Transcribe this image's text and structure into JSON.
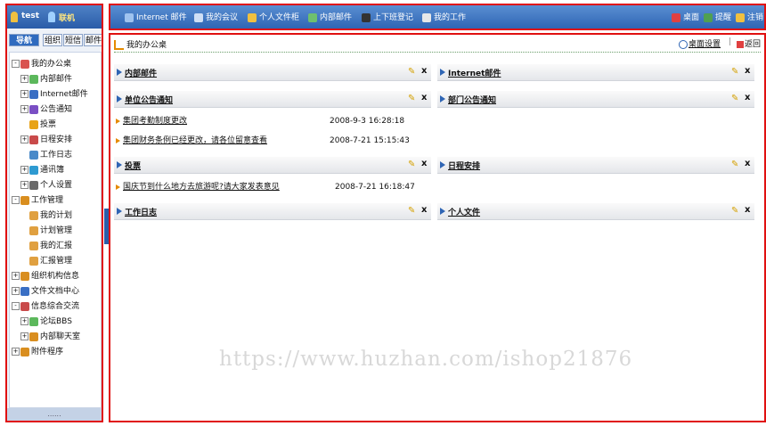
{
  "user": {
    "name": "test",
    "status": "联机"
  },
  "left_tabs": [
    "导航",
    "组织",
    "短信",
    "邮件"
  ],
  "tree": [
    {
      "label": "我的办公桌",
      "expander": "-",
      "color": "#d9534f"
    },
    {
      "label": "内部邮件",
      "expander": "+",
      "color": "#5cb85c"
    },
    {
      "label": "Internet邮件",
      "expander": "+",
      "color": "#3a6fc4"
    },
    {
      "label": "公告通知",
      "expander": "+",
      "color": "#7a4fc4"
    },
    {
      "label": "投票",
      "expander": "",
      "color": "#e8a317"
    },
    {
      "label": "日程安排",
      "expander": "+",
      "color": "#c94a4a"
    },
    {
      "label": "工作日志",
      "expander": "",
      "color": "#4a8ac9"
    },
    {
      "label": "通讯簿",
      "expander": "+",
      "color": "#2e9ad1"
    },
    {
      "label": "个人设置",
      "expander": "+",
      "color": "#6a6a6a"
    },
    {
      "label": "工作管理",
      "expander": "-",
      "color": "#d98e1f"
    },
    {
      "label": "我的计划",
      "expander": "",
      "color": "#e0a040"
    },
    {
      "label": "计划管理",
      "expander": "",
      "color": "#e0a040"
    },
    {
      "label": "我的汇报",
      "expander": "",
      "color": "#e0a040"
    },
    {
      "label": "汇报管理",
      "expander": "",
      "color": "#e0a040"
    },
    {
      "label": "组织机构信息",
      "expander": "+",
      "color": "#d98e1f"
    },
    {
      "label": "文件文档中心",
      "expander": "+",
      "color": "#3a6fc4"
    },
    {
      "label": "信息综合交流",
      "expander": "-",
      "color": "#c94a4a"
    },
    {
      "label": "论坛BBS",
      "expander": "+",
      "color": "#5cb85c"
    },
    {
      "label": "内部聊天室",
      "expander": "+",
      "color": "#d98e1f"
    },
    {
      "label": "附件程序",
      "expander": "+",
      "color": "#d98e1f"
    }
  ],
  "left_footer": "......",
  "toolbar": [
    {
      "label": "Internet 邮件",
      "color": "#9fc3ef"
    },
    {
      "label": "我的会议",
      "color": "#cfdff5"
    },
    {
      "label": "个人文件柜",
      "color": "#f0c040"
    },
    {
      "label": "内部邮件",
      "color": "#6ec06e"
    },
    {
      "label": "上下班登记",
      "color": "#333"
    },
    {
      "label": "我的工作",
      "color": "#e8e8e8"
    }
  ],
  "toolbar_right": [
    {
      "label": "桌面",
      "color": "#e04040"
    },
    {
      "label": "提醒",
      "color": "#50a050"
    },
    {
      "label": "注销",
      "color": "#f0c040"
    }
  ],
  "breadcrumb": "我的办公桌",
  "desk_settings": "桌面设置",
  "return_label": "返回",
  "panels": {
    "internal_mail": "内部邮件",
    "internet_mail": "Internet邮件",
    "unit_notice": "单位公告通知",
    "dept_notice": "部门公告通知",
    "vote": "投票",
    "schedule": "日程安排",
    "work_log": "工作日志",
    "personal_files": "个人文件"
  },
  "unit_notice_items": [
    {
      "title": "集团考勤制度更改",
      "time": "2008-9-3 16:28:18"
    },
    {
      "title": "集团财务条例已经更改，请各位留意查看",
      "time": "2008-7-21 15:15:43"
    }
  ],
  "vote_items": [
    {
      "title": "国庆节到什么地方去旅游呢?请大家发表意见",
      "time": "2008-7-21 16:18:47"
    }
  ],
  "close_glyph": "x",
  "watermark": "https://www.huzhan.com/ishop21876"
}
